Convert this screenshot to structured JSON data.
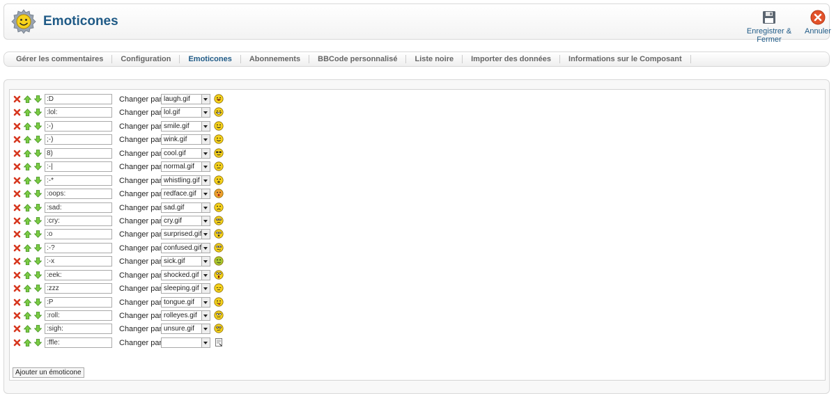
{
  "header": {
    "title": "Emoticones",
    "save_label": "Enregistrer & Fermer",
    "cancel_label": "Annuler"
  },
  "submenu": [
    {
      "label": "Gérer les commentaires",
      "active": false
    },
    {
      "label": "Configuration",
      "active": false
    },
    {
      "label": "Emoticones",
      "active": true
    },
    {
      "label": "Abonnements",
      "active": false
    },
    {
      "label": "BBCode personnalisé",
      "active": false
    },
    {
      "label": "Liste noire",
      "active": false
    },
    {
      "label": "Importer des données",
      "active": false
    },
    {
      "label": "Informations sur le Composant",
      "active": false
    }
  ],
  "change_label": "Changer par",
  "emoticons": [
    {
      "code": ":D",
      "image": "laugh.gif",
      "icon": "laugh-smiley-icon"
    },
    {
      "code": ":lol:",
      "image": "lol.gif",
      "icon": "lol-smiley-icon"
    },
    {
      "code": ":-)",
      "image": "smile.gif",
      "icon": "smile-smiley-icon"
    },
    {
      "code": ";-)",
      "image": "wink.gif",
      "icon": "wink-smiley-icon"
    },
    {
      "code": "8)",
      "image": "cool.gif",
      "icon": "cool-smiley-icon"
    },
    {
      "code": ":-|",
      "image": "normal.gif",
      "icon": "normal-smiley-icon"
    },
    {
      "code": ":-*",
      "image": "whistling.gif",
      "icon": "whistling-smiley-icon"
    },
    {
      "code": ":oops:",
      "image": "redface.gif",
      "icon": "redface-smiley-icon"
    },
    {
      "code": ":sad:",
      "image": "sad.gif",
      "icon": "sad-smiley-icon"
    },
    {
      "code": ":cry:",
      "image": "cry.gif",
      "icon": "cry-smiley-icon"
    },
    {
      "code": ":o",
      "image": "surprised.gif",
      "icon": "surprised-smiley-icon"
    },
    {
      "code": ":-?",
      "image": "confused.gif",
      "icon": "confused-smiley-icon"
    },
    {
      "code": ":-x",
      "image": "sick.gif",
      "icon": "sick-smiley-icon"
    },
    {
      "code": ":eek:",
      "image": "shocked.gif",
      "icon": "shocked-smiley-icon"
    },
    {
      "code": ":zzz",
      "image": "sleeping.gif",
      "icon": "sleeping-smiley-icon"
    },
    {
      "code": ":P",
      "image": "tongue.gif",
      "icon": "tongue-smiley-icon"
    },
    {
      "code": ":roll:",
      "image": "rolleyes.gif",
      "icon": "rolleyes-smiley-icon"
    },
    {
      "code": ":sigh:",
      "image": "unsure.gif",
      "icon": "unsure-smiley-icon"
    },
    {
      "code": ":ffle:",
      "image": "",
      "icon": "blank-image-icon"
    }
  ],
  "add_button_label": "Ajouter un émoticone",
  "colors": {
    "title": "#1f5a86",
    "active_tab": "#1f5a86",
    "delete": "#d6361e",
    "arrow": "#5fb832",
    "smiley": "#f6d21c"
  }
}
